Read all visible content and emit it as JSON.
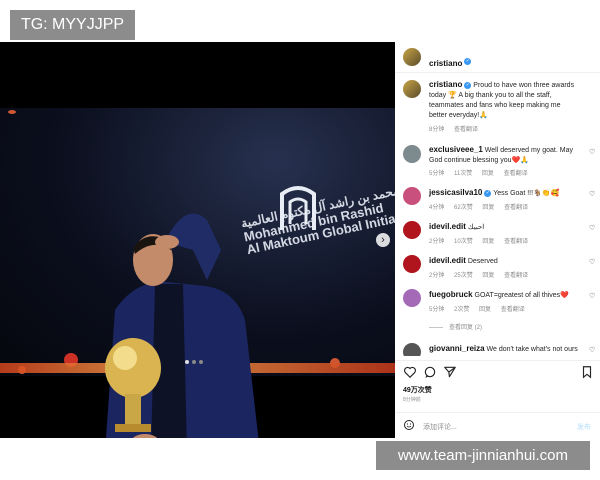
{
  "watermark_top": "TG: MYYJJPP",
  "watermark_bottom": "www.team-jinnianhui.com",
  "post": {
    "author": "cristiano",
    "caption": "Proud to have won three awards today 🏆 A big thank you to all the staff, teammates and fans who keep making me better everyday!🙏",
    "caption_time": "8分钟",
    "see_translation": "查看翻译",
    "reply": "回复",
    "sign_text": "مؤسسة محمد بن راشد آل مكتوم العالمية",
    "sign_text_en_1": "Mohammed bin Rashid",
    "sign_text_en_2": "Al Maktoum Global Initiatives",
    "likes": "49万次赞",
    "likes_time": "8分钟前",
    "comment_placeholder": "添加评论...",
    "comment_post": "发布",
    "comments": [
      {
        "user": "exclusiveee_1",
        "text": "Well deserved my goat. May God continue blessing you❤️🙏",
        "time": "5分钟",
        "likes": "11次赞"
      },
      {
        "user": "jessicasilva10",
        "text": "Yess Goat !!!🐐👏🥰",
        "time": "4分钟",
        "likes": "62次赞"
      },
      {
        "user": "idevil.edit",
        "text": "احبيك",
        "time": "2分钟",
        "likes": "10次赞"
      },
      {
        "user": "idevil.edit",
        "text": "Deserved",
        "time": "2分钟",
        "likes": "25次赞"
      },
      {
        "user": "fuegobruck",
        "text": "GOAT=greatest of all thives❤️",
        "time": "5分钟",
        "likes": "2次赞"
      },
      {
        "user": "giovanni_reiza",
        "text": "We don't take what's not ours",
        "time": "",
        "likes": ""
      }
    ],
    "view_replies": "查看回复 (2)"
  }
}
